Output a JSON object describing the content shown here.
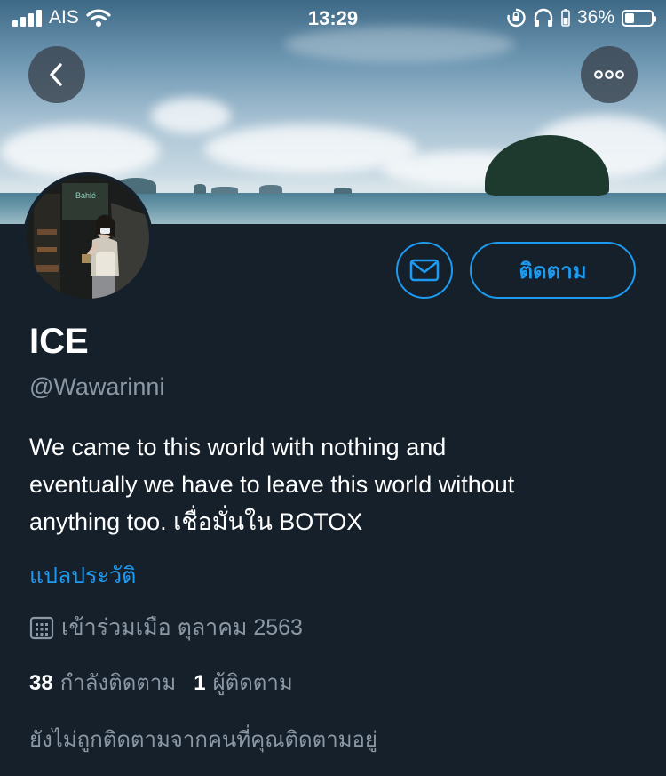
{
  "status_bar": {
    "carrier": "AIS",
    "time": "13:29",
    "battery_percent": "36%",
    "battery_level": 0.36
  },
  "header": {
    "back_icon": "chevron-left-icon",
    "more_icon": "more-horizontal-icon"
  },
  "profile": {
    "name": "ICE",
    "handle": "@Wawarinni",
    "bio": "We came to this world with nothing and\neventually we have to leave this world without\nanything too. เชื่อมั่นใน BOTOX",
    "translate_label": "แปลประวัติ",
    "joined": "เข้าร่วมเมือ ตุลาคม 2563",
    "following_count": "38",
    "following_label": "กำลังติดตาม",
    "followers_count": "1",
    "followers_label": "ผู้ติดตาม",
    "not_followed_text": "ยังไม่ถูกติดตามจากคนที่คุณติดตามอยู่"
  },
  "actions": {
    "message_icon": "envelope-icon",
    "follow_label": "ติดตาม"
  },
  "colors": {
    "background": "#15202b",
    "accent": "#1d9bf0",
    "secondary_text": "#8b98a5"
  }
}
